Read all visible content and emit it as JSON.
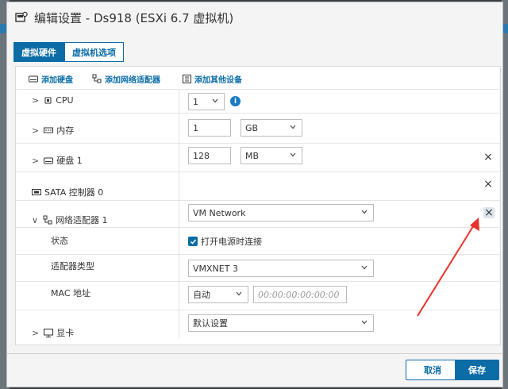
{
  "window": {
    "title": "编辑设置 - Ds918 (ESXi 6.7 虚拟机)"
  },
  "tabs": [
    {
      "label": "虚拟硬件",
      "active": true
    },
    {
      "label": "虚拟机选项",
      "active": false
    }
  ],
  "toolbar": {
    "add_disk": "添加硬盘",
    "add_network": "添加网络适配器",
    "add_other": "添加其他设备"
  },
  "hardware": {
    "cpu": {
      "label": "CPU",
      "value": "1"
    },
    "memory": {
      "label": "内存",
      "value": "1",
      "unit": "GB"
    },
    "disk": {
      "label": "硬盘 1",
      "value": "128",
      "unit": "MB"
    },
    "sata": {
      "label": "SATA 控制器 0"
    },
    "network": {
      "label": "网络适配器 1",
      "value": "VM Network",
      "status_label": "状态",
      "status_checkbox": "打开电源时连接",
      "status_checked": true,
      "adapter_type_label": "适配器类型",
      "adapter_type_value": "VMXNET 3",
      "mac_label": "MAC 地址",
      "mac_mode": "自动",
      "mac_placeholder": "00:00:00:00:00:00"
    },
    "display": {
      "label": "显卡",
      "value": "默认设置"
    }
  },
  "buttons": {
    "cancel": "取消",
    "save": "保存"
  },
  "colors": {
    "accent": "#0b6ca6",
    "annotation": "#e8322a"
  }
}
